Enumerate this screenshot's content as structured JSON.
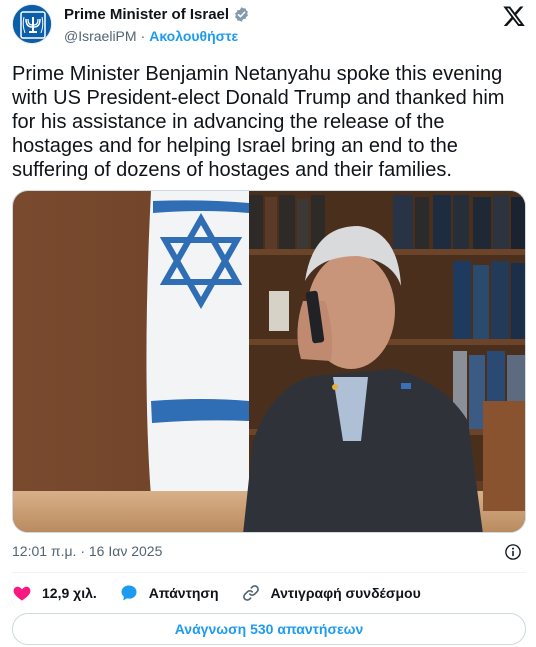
{
  "account": {
    "display_name": "Prime Minister of Israel",
    "handle": "@IsraeliPM",
    "separator": "·",
    "follow_label": "Ακολουθήστε"
  },
  "tweet": {
    "text": "Prime Minister Benjamin Netanyahu spoke this evening with US President-elect Donald Trump and thanked him for his assistance in advancing the release of the hostages and for helping Israel bring an end to the suffering of dozens of hostages and their families.",
    "timestamp": "12:01 π.μ. · 16 Ιαν 2025"
  },
  "actions": {
    "likes_count": "12,9 χιλ.",
    "reply_label": "Απάντηση",
    "copy_link_label": "Αντιγραφή συνδέσμου"
  },
  "read_replies_label": "Ανάγνωση 530 απαντήσεων",
  "icons": [
    "emblem-avatar-icon",
    "verified-badge-icon",
    "x-logo-icon",
    "info-icon",
    "heart-icon",
    "reply-bubble-icon",
    "link-icon"
  ],
  "colors": {
    "accent": "#1d9bf0",
    "like": "#f91880",
    "text": "#0f1419",
    "muted": "#536471",
    "verified": "#829aab"
  }
}
